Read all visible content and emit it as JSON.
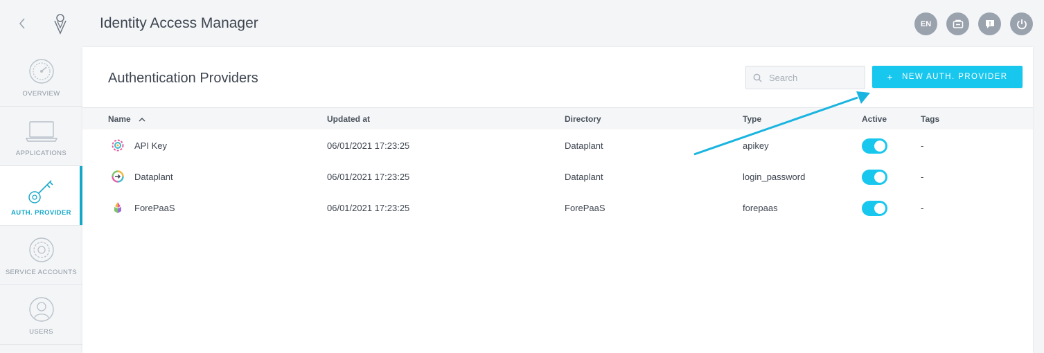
{
  "app": {
    "title": "Identity Access Manager"
  },
  "top_actions": {
    "language": "EN"
  },
  "sidebar": {
    "items": [
      {
        "label": "OVERVIEW"
      },
      {
        "label": "APPLICATIONS"
      },
      {
        "label": "AUTH. PROVIDER"
      },
      {
        "label": "SERVICE ACCOUNTS"
      },
      {
        "label": "USERS"
      }
    ]
  },
  "main": {
    "title": "Authentication Providers",
    "search": {
      "placeholder": "Search"
    },
    "new_button": {
      "label": "NEW AUTH. PROVIDER"
    },
    "columns": {
      "name": "Name",
      "updated": "Updated at",
      "directory": "Directory",
      "type": "Type",
      "active": "Active",
      "tags": "Tags"
    },
    "rows": [
      {
        "name": "API Key",
        "updated": "06/01/2021 17:23:25",
        "directory": "Dataplant",
        "type": "apikey",
        "active": true,
        "tags": "-"
      },
      {
        "name": "Dataplant",
        "updated": "06/01/2021 17:23:25",
        "directory": "Dataplant",
        "type": "login_password",
        "active": true,
        "tags": "-"
      },
      {
        "name": "ForePaaS",
        "updated": "06/01/2021 17:23:25",
        "directory": "ForePaaS",
        "type": "forepaas",
        "active": true,
        "tags": "-"
      }
    ]
  },
  "colors": {
    "accent": "#18c7ee",
    "active_nav": "#14a9c9",
    "annotation_arrow": "#1ab4e0"
  }
}
